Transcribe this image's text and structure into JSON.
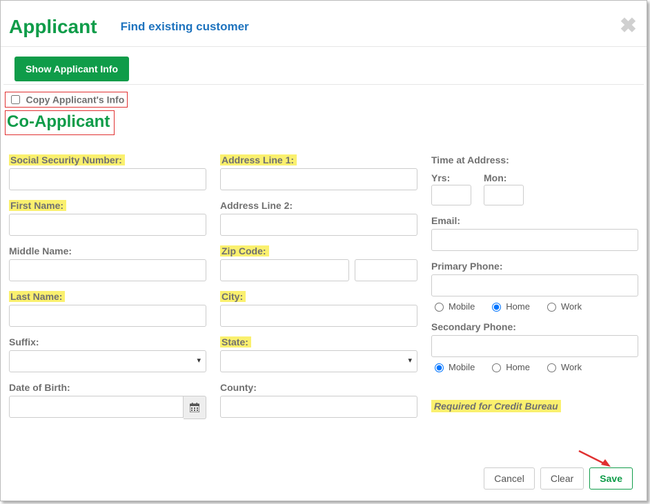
{
  "header": {
    "title": "Applicant",
    "link": "Find existing customer"
  },
  "buttons": {
    "show_info": "Show Applicant Info",
    "cancel": "Cancel",
    "clear": "Clear",
    "save": "Save"
  },
  "copy_checkbox_label": "Copy Applicant's Info",
  "coapplicant_title": "Co-Applicant",
  "labels": {
    "ssn": "Social Security Number:",
    "first": "First Name:",
    "middle": "Middle Name:",
    "last": "Last Name:",
    "suffix": "Suffix:",
    "dob": "Date of Birth:",
    "addr1": "Address Line 1:",
    "addr2": "Address Line 2:",
    "zip": "Zip Code:",
    "city": "City:",
    "state": "State:",
    "county": "County:",
    "time_at_address": "Time at Address:",
    "yrs": "Yrs:",
    "mon": "Mon:",
    "email": "Email:",
    "primary_phone": "Primary Phone:",
    "secondary_phone": "Secondary Phone:"
  },
  "radio": {
    "mobile": "Mobile",
    "home": "Home",
    "work": "Work",
    "primary_selected": "home",
    "secondary_selected": "mobile"
  },
  "required_note": "Required for Credit Bureau",
  "values": {
    "ssn": "",
    "first": "",
    "middle": "",
    "last": "",
    "suffix": "",
    "dob": "",
    "addr1": "",
    "addr2": "",
    "zip": "",
    "zip4": "",
    "city": "",
    "state": "",
    "county": "",
    "yrs": "",
    "mon": "",
    "email": "",
    "primary_phone": "",
    "secondary_phone": ""
  }
}
